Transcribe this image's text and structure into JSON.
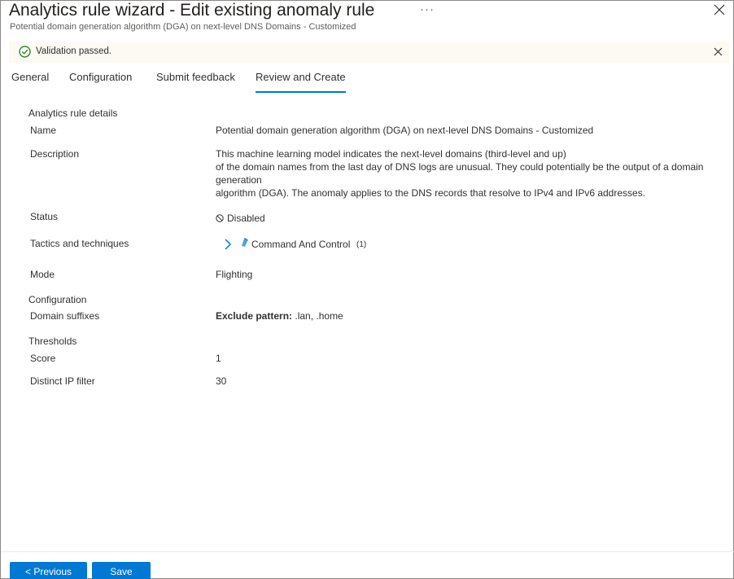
{
  "header": {
    "title": "Analytics rule wizard - Edit existing anomaly rule",
    "subtitle": "Potential domain generation algorithm (DGA) on next-level DNS Domains - Customized",
    "more_label": "···"
  },
  "banner": {
    "message": "Validation passed."
  },
  "tabs": [
    {
      "label": "General"
    },
    {
      "label": "Configuration"
    },
    {
      "label": "Submit feedback"
    },
    {
      "label": "Review and Create",
      "active": true
    }
  ],
  "details": {
    "section_title": "Analytics rule details",
    "name_label": "Name",
    "name_value": "Potential domain generation algorithm (DGA) on next-level DNS Domains - Customized",
    "description_label": "Description",
    "description_lines": [
      "This machine learning model indicates the next-level domains (third-level and up)",
      "of the domain names from the last day of DNS logs are unusual. They could potentially be the output of a domain generation",
      "algorithm (DGA). The anomaly applies to the DNS records that resolve to IPv4 and IPv6 addresses."
    ],
    "status_label": "Status",
    "status_value": "Disabled",
    "tactics_label": "Tactics and techniques",
    "tactic_name": "Command And Control",
    "tactic_count": "(1)",
    "mode_label": "Mode",
    "mode_value": "Flighting"
  },
  "configuration": {
    "section_title": "Configuration",
    "domain_label": "Domain suffixes",
    "exclude_label": "Exclude pattern:",
    "exclude_value": " .lan, .home"
  },
  "thresholds": {
    "section_title": "Thresholds",
    "score_label": "Score",
    "score_value": "1",
    "ip_label": "Distinct IP filter",
    "ip_value": "30"
  },
  "footer": {
    "previous_label": "< Previous",
    "save_label": "Save"
  },
  "colors": {
    "accent": "#0078d4",
    "success": "#107c10",
    "banner_bg": "#fcfaf3"
  },
  "icons": {
    "close": "close-icon",
    "check": "check-circle-icon",
    "status": "disabled-circle-icon",
    "chevron": "chevron-right-icon",
    "tactic": "command-control-icon"
  }
}
